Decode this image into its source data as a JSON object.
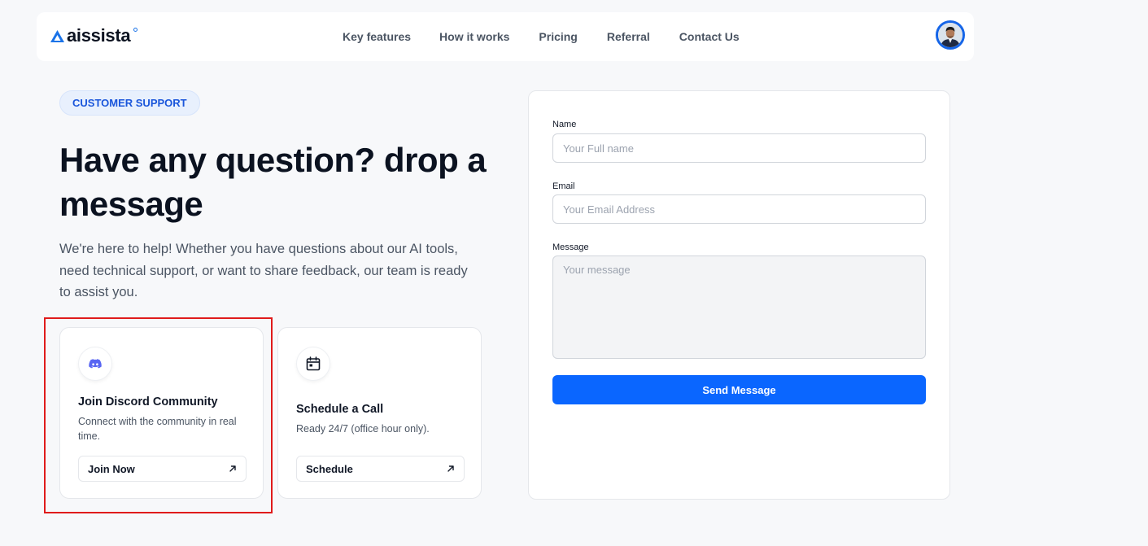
{
  "brand": {
    "name": "aissista",
    "accent": "#0a66ff",
    "logo_icon": "triangle-logo-icon"
  },
  "nav": {
    "links": [
      "Key features",
      "How it works",
      "Pricing",
      "Referral",
      "Contact Us"
    ]
  },
  "profile": {
    "icon": "user-avatar"
  },
  "hero": {
    "badge": "CUSTOMER SUPPORT",
    "title": "Have any question? drop a message",
    "description": "We're here to help! Whether you have questions about our AI tools, need technical support, or want to share feedback, our team is ready to assist you."
  },
  "cards": [
    {
      "icon": "discord-icon",
      "title": "Join Discord Community",
      "description": "Connect with the community in real time.",
      "button": "Join Now"
    },
    {
      "icon": "calendar-icon",
      "title": "Schedule a Call",
      "description": "Ready 24/7 (office hour only).",
      "button": "Schedule"
    }
  ],
  "form": {
    "name_label": "Name",
    "name_placeholder": "Your Full name",
    "email_label": "Email",
    "email_placeholder": "Your Email Address",
    "message_label": "Message",
    "message_placeholder": "Your message",
    "submit": "Send Message"
  },
  "colors": {
    "highlight_box": "#e01b1b",
    "badge_text": "#1a56db",
    "button_bg": "#0a66ff"
  }
}
